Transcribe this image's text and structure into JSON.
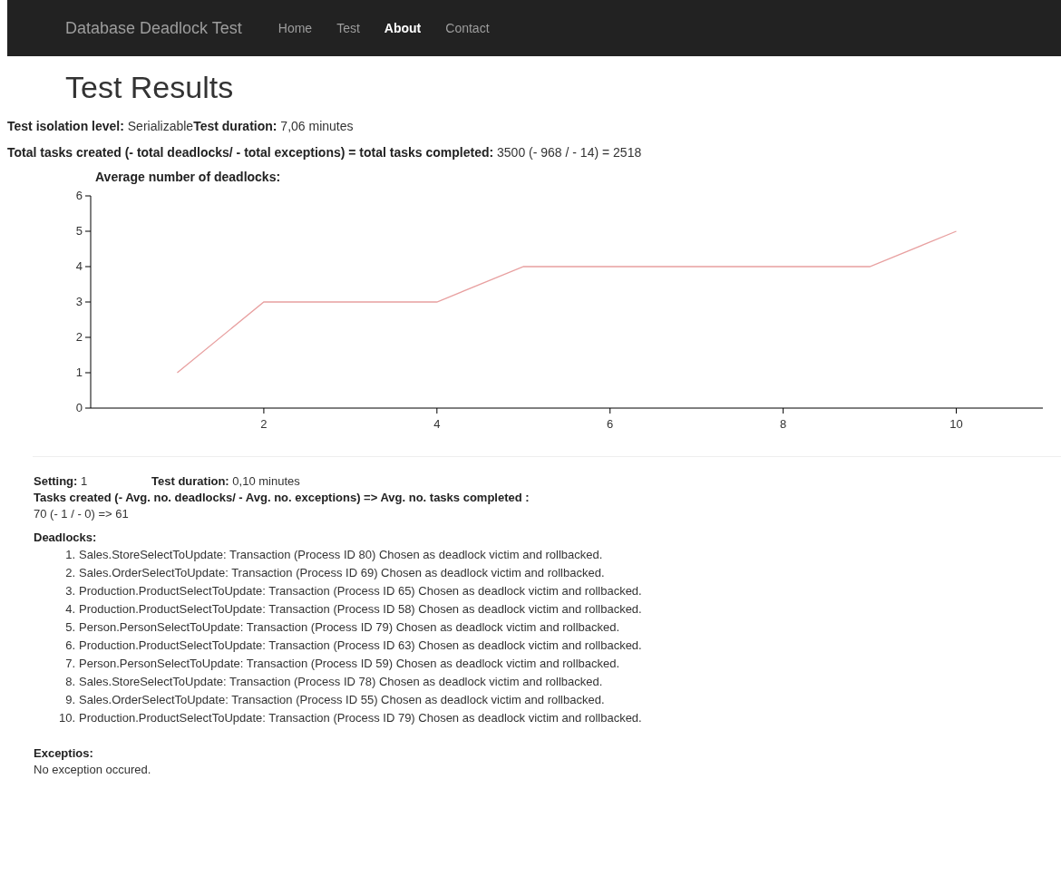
{
  "navbar": {
    "brand": "Database Deadlock Test",
    "links": [
      {
        "label": "Home",
        "selected": false
      },
      {
        "label": "Test",
        "selected": false
      },
      {
        "label": "About",
        "selected": true
      },
      {
        "label": "Contact",
        "selected": false
      }
    ]
  },
  "title": "Test Results",
  "summary": {
    "isolation": "**Test isolation level:** Serializable",
    "duration": "**Test duration:** 7,06 minutes",
    "totals": "**Total tasks created (- total deadlocks/ - total exceptions) = total tasks completed:** 3500 (- 968 / - 14) = 2518"
  },
  "chart": {
    "chart_data": {
      "type": "line",
      "title": "Average number of deadlocks:",
      "x": [
        1,
        2,
        3,
        4,
        5,
        6,
        7,
        8,
        9,
        10
      ],
      "xlim": [
        0,
        11
      ],
      "ylim": [
        0,
        6
      ],
      "xticks": [
        2,
        4,
        6,
        8,
        10
      ],
      "yticks": [
        0,
        1,
        2,
        3,
        4,
        5,
        6
      ],
      "series": [
        {
          "color": "#e8a0a0",
          "values": [
            1,
            3,
            3,
            3,
            4,
            4,
            4,
            4,
            4,
            5
          ]
        }
      ]
    }
  },
  "setting": {
    "setting": "**Setting:** 1",
    "duration": "**Test duration:** 0,10 minutes",
    "tasks_label": "Tasks created (- Avg. no. deadlocks/ - Avg. no. exceptions) => Avg. no. tasks completed :",
    "tasks_value": "70 (- 1 / - 0) => 61",
    "deadlocks_heading": "Deadlocks:",
    "deadlocks": [
      {
        "number": "1.",
        "text": "Sales.StoreSelectToUpdate: Transaction (Process ID 80) Chosen as deadlock victim and rollbacked."
      },
      {
        "number": "2.",
        "text": "Sales.OrderSelectToUpdate: Transaction (Process ID 69) Chosen as deadlock victim and rollbacked."
      },
      {
        "number": "3.",
        "text": "Production.ProductSelectToUpdate: Transaction (Process ID 65) Chosen as deadlock victim and rollbacked."
      },
      {
        "number": "4.",
        "text": "Production.ProductSelectToUpdate: Transaction (Process ID 58) Chosen as deadlock victim and rollbacked."
      },
      {
        "number": "5.",
        "text": "Person.PersonSelectToUpdate: Transaction (Process ID 79) Chosen as deadlock victim and rollbacked."
      },
      {
        "number": "6.",
        "text": "Production.ProductSelectToUpdate: Transaction (Process ID 63) Chosen as deadlock victim and rollbacked."
      },
      {
        "number": "7.",
        "text": "Person.PersonSelectToUpdate: Transaction (Process ID 59) Chosen as deadlock victim and rollbacked."
      },
      {
        "number": "8.",
        "text": "Sales.StoreSelectToUpdate: Transaction (Process ID 78) Chosen as deadlock victim and rollbacked."
      },
      {
        "number": "9.",
        "text": "Sales.OrderSelectToUpdate: Transaction (Process ID 55) Chosen as deadlock victim and rollbacked."
      },
      {
        "number": "10.",
        "text": "Production.ProductSelectToUpdate: Transaction (Process ID 79) Chosen as deadlock victim and rollbacked."
      }
    ],
    "exceptions_heading": "Exceptios:",
    "exceptions_text": "No exception occured."
  }
}
